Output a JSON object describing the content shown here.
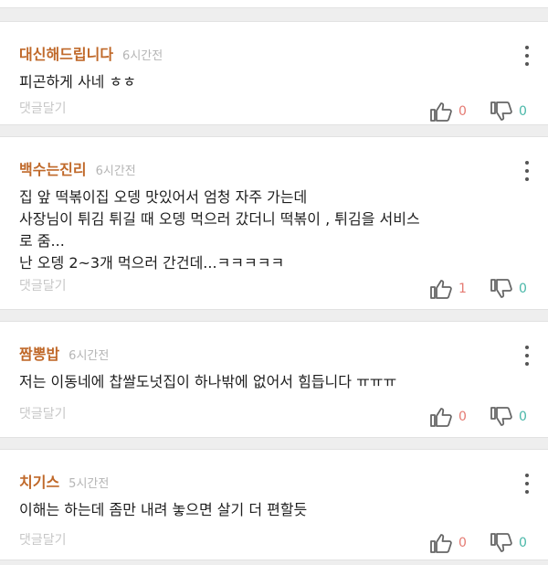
{
  "comments": [
    {
      "author": "대신해드립니다",
      "time": "6시간전",
      "text": "피곤하게 사네 ㅎㅎ",
      "reply_label": "댓글달기",
      "likes": "0",
      "dislikes": "0"
    },
    {
      "author": "백수는진리",
      "time": "6시간전",
      "text": "집 앞 떡볶이집 오뎅 맛있어서 엄청 자주 가는데\n사장님이 튀김 튀길 때 오뎅 먹으러 갔더니 떡볶이 , 튀김을 서비스\n로 줌...\n난 오뎅 2~3개 먹으러 간건데...ㅋㅋㅋㅋㅋ",
      "reply_label": "댓글달기",
      "likes": "1",
      "dislikes": "0"
    },
    {
      "author": "짬뽕밥",
      "time": "6시간전",
      "text": "저는 이동네에 찹쌀도넛집이 하나밖에 없어서 힘듭니다 ㅠㅠㅠ",
      "reply_label": "댓글달기",
      "likes": "0",
      "dislikes": "0"
    },
    {
      "author": "치기스",
      "time": "5시간전",
      "text": "이해는 하는데 좀만 내려 놓으면 살기 더 편할듯",
      "reply_label": "댓글달기",
      "likes": "0",
      "dislikes": "0"
    }
  ],
  "icons": {
    "more": "more-vertical-icon",
    "like": "thumbs-up-icon",
    "dislike": "thumbs-down-icon"
  },
  "colors": {
    "author": "#c0692a",
    "like_count": "#e57a72",
    "dislike_count": "#49b7a8"
  }
}
